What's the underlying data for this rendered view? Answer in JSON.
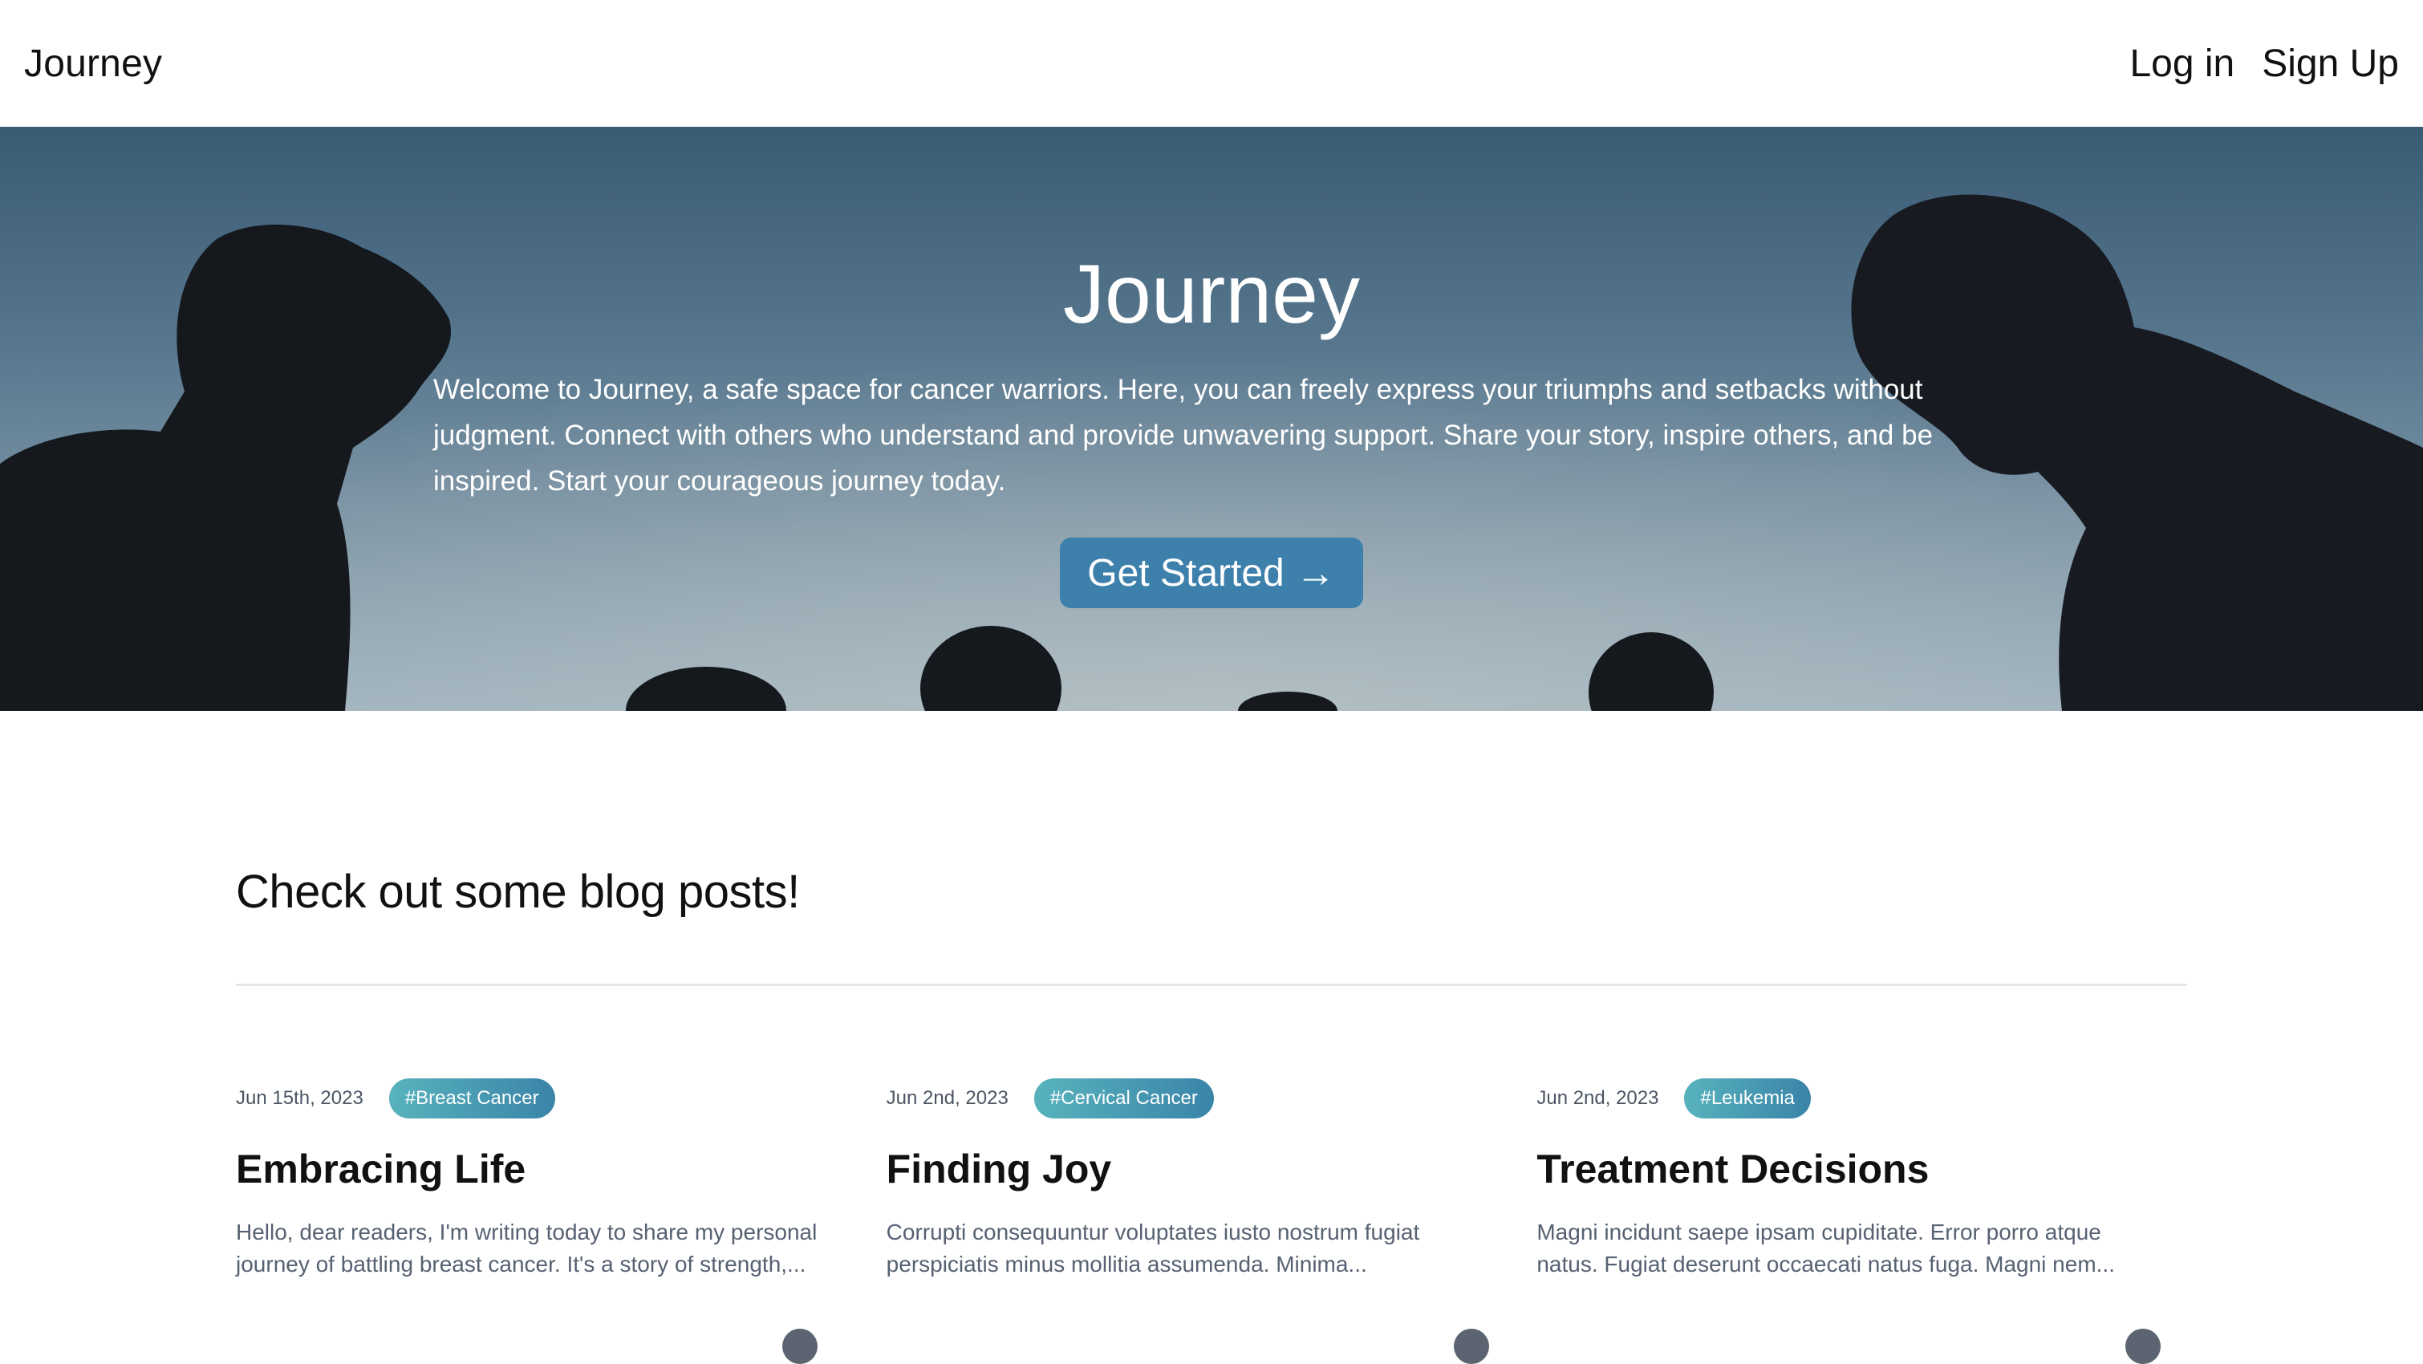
{
  "header": {
    "brand": "Journey",
    "login_label": "Log in",
    "signup_label": "Sign Up"
  },
  "hero": {
    "title": "Journey",
    "text": "Welcome to Journey, a safe space for cancer warriors. Here, you can freely express your triumphs and setbacks without judgment. Connect with others who understand and provide unwavering support. Share your story, inspire others, and be inspired. Start your courageous journey today.",
    "cta_label": "Get Started",
    "cta_icon": "→"
  },
  "blog": {
    "heading": "Check out some blog posts!",
    "posts": [
      {
        "date": "Jun 15th, 2023",
        "tag": "#Breast Cancer",
        "title": "Embracing Life",
        "excerpt": "Hello, dear readers, I'm writing today to share my personal journey of battling breast cancer. It's a story of strength,..."
      },
      {
        "date": "Jun 2nd, 2023",
        "tag": "#Cervical Cancer",
        "title": "Finding Joy",
        "excerpt": "Corrupti consequuntur voluptates iusto nostrum fugiat perspiciatis minus mollitia assumenda. Minima..."
      },
      {
        "date": "Jun 2nd, 2023",
        "tag": "#Leukemia",
        "title": "Treatment Decisions",
        "excerpt": "Magni incidunt saepe ipsam cupiditate. Error porro atque natus. Fugiat deserunt occaecati natus fuga. Magni nem..."
      }
    ]
  },
  "colors": {
    "cta": "#3d80ab",
    "tag_start": "#58b3bd",
    "tag_end": "#3a84a8"
  }
}
